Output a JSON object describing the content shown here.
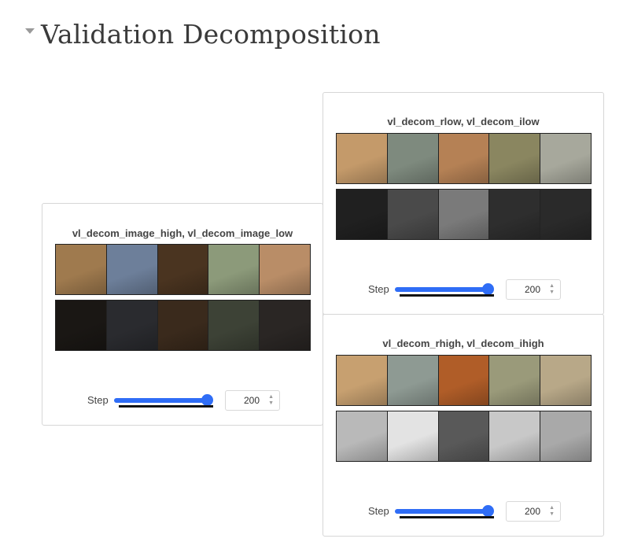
{
  "section": {
    "title": "Validation Decomposition"
  },
  "panels": [
    {
      "title": "vl_decom_image_high, vl_decom_image_low",
      "step_label": "Step",
      "step_value": "200",
      "slider_fraction": 1.0,
      "rows": [
        [
          "#9f7a4e",
          "#6d7f9a",
          "#4a3420",
          "#8c9a7a",
          "#b98d67"
        ],
        [
          "#1a1714",
          "#2a2b2f",
          "#3a2a1c",
          "#3d4236",
          "#2a2624"
        ]
      ]
    },
    {
      "title": "vl_decom_rlow, vl_decom_ilow",
      "step_label": "Step",
      "step_value": "200",
      "slider_fraction": 1.0,
      "rows": [
        [
          "#c49a6a",
          "#7e8a7e",
          "#b58155",
          "#8a8660",
          "#a7a89c"
        ],
        [
          "#202020",
          "#4a4a4a",
          "#7a7a7a",
          "#2e2e2e",
          "#2a2a2a"
        ]
      ]
    },
    {
      "title": "vl_decom_rhigh, vl_decom_ihigh",
      "step_label": "Step",
      "step_value": "200",
      "slider_fraction": 1.0,
      "rows": [
        [
          "#c7a070",
          "#8e9a93",
          "#b05d28",
          "#9a9a7a",
          "#b8a888"
        ],
        [
          "#b9b9b9",
          "#e3e3e3",
          "#595959",
          "#c8c8c8",
          "#a9a9a9"
        ]
      ]
    }
  ]
}
